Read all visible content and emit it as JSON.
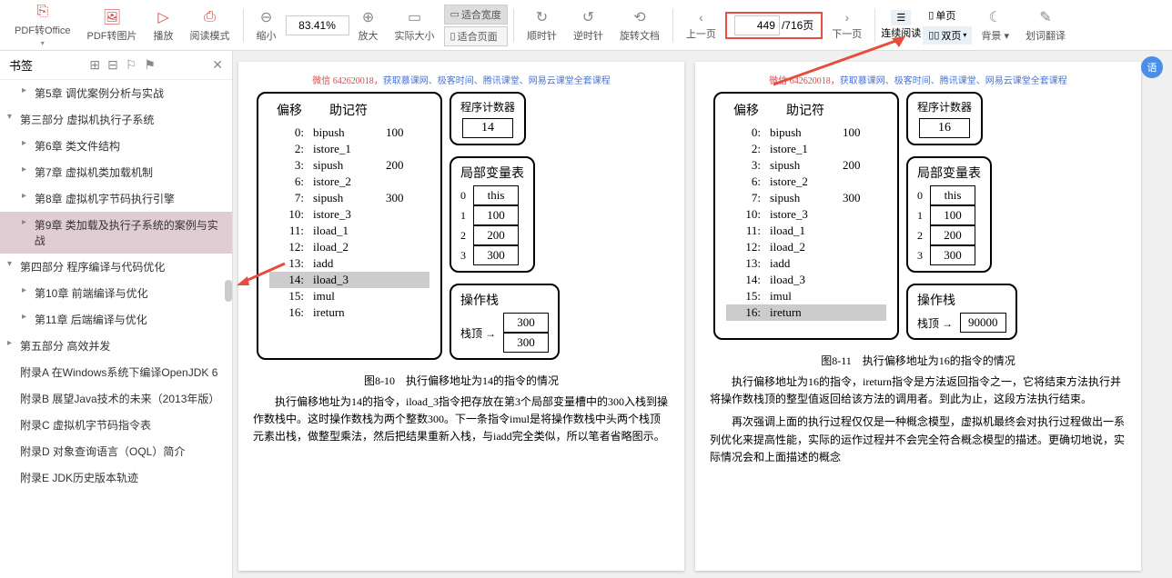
{
  "toolbar": {
    "pdf_office": "PDF转Office",
    "pdf_image": "PDF转图片",
    "play": "播放",
    "read_mode": "阅读模式",
    "zoom_out": "缩小",
    "zoom_value": "83.41%",
    "zoom_in": "放大",
    "actual_size": "实际大小",
    "fit_width": "适合宽度",
    "fit_page": "适合页面",
    "rotate_cw": "顺时针",
    "rotate_ccw": "逆时针",
    "rotate_doc": "旋转文档",
    "prev_page": "上一页",
    "page_current": "449",
    "page_total": "/716页",
    "next_page": "下一页",
    "continuous": "连续阅读",
    "single_page": "单页",
    "double_page": "双页",
    "background": "背景",
    "word_trans": "划词翻译"
  },
  "sidebar": {
    "title": "书签",
    "items": [
      {
        "label": "第5章 调优案例分析与实战",
        "lv": 1,
        "arrow": "▸"
      },
      {
        "label": "第三部分 虚拟机执行子系统",
        "lv": 0,
        "arrow": "▾"
      },
      {
        "label": "第6章 类文件结构",
        "lv": 1,
        "arrow": "▸"
      },
      {
        "label": "第7章 虚拟机类加载机制",
        "lv": 1,
        "arrow": "▸"
      },
      {
        "label": "第8章 虚拟机字节码执行引擎",
        "lv": 1,
        "arrow": "▸"
      },
      {
        "label": "第9章 类加载及执行子系统的案例与实战",
        "lv": 1,
        "arrow": "▸",
        "selected": true
      },
      {
        "label": "第四部分 程序编译与代码优化",
        "lv": 0,
        "arrow": "▾"
      },
      {
        "label": "第10章 前端编译与优化",
        "lv": 1,
        "arrow": "▸"
      },
      {
        "label": "第11章 后端编译与优化",
        "lv": 1,
        "arrow": "▸"
      },
      {
        "label": "第五部分 高效并发",
        "lv": 0,
        "arrow": "▸"
      },
      {
        "label": "附录A 在Windows系统下编译OpenJDK 6",
        "lv": 0,
        "arrow": ""
      },
      {
        "label": "附录B 展望Java技术的未来（2013年版）",
        "lv": 0,
        "arrow": ""
      },
      {
        "label": "附录C 虚拟机字节码指令表",
        "lv": 0,
        "arrow": ""
      },
      {
        "label": "附录D 对象查询语言（OQL）简介",
        "lv": 0,
        "arrow": ""
      },
      {
        "label": "附录E JDK历史版本轨迹",
        "lv": 0,
        "arrow": ""
      }
    ]
  },
  "doc": {
    "header_prefix": "微信 642620018，",
    "header_links": "获取慕课网、极客时间、腾讯课堂、网易云课堂全套课程",
    "left": {
      "code_title_offset": "偏移",
      "code_title_mnemonic": "助记符",
      "rows": [
        {
          "off": "0:",
          "mn": "bipush",
          "arg": "100"
        },
        {
          "off": "2:",
          "mn": "istore_1",
          "arg": ""
        },
        {
          "off": "3:",
          "mn": "sipush",
          "arg": "200"
        },
        {
          "off": "6:",
          "mn": "istore_2",
          "arg": ""
        },
        {
          "off": "7:",
          "mn": "sipush",
          "arg": "300"
        },
        {
          "off": "10:",
          "mn": "istore_3",
          "arg": ""
        },
        {
          "off": "11:",
          "mn": "iload_1",
          "arg": ""
        },
        {
          "off": "12:",
          "mn": "iload_2",
          "arg": ""
        },
        {
          "off": "13:",
          "mn": "iadd",
          "arg": ""
        },
        {
          "off": "14:",
          "mn": "iload_3",
          "arg": "",
          "hl": true
        },
        {
          "off": "15:",
          "mn": "imul",
          "arg": ""
        },
        {
          "off": "16:",
          "mn": "ireturn",
          "arg": ""
        }
      ],
      "pc_title": "程序计数器",
      "pc_value": "14",
      "var_title": "局部变量表",
      "vars": [
        {
          "i": "0",
          "v": "this"
        },
        {
          "i": "1",
          "v": "100"
        },
        {
          "i": "2",
          "v": "200"
        },
        {
          "i": "3",
          "v": "300"
        }
      ],
      "stack_title": "操作栈",
      "stack_label": "栈顶 →",
      "stack": [
        "300",
        "300"
      ],
      "caption": "图8-10　执行偏移地址为14的指令的情况",
      "para": "执行偏移地址为14的指令，iload_3指令把存放在第3个局部变量槽中的300入栈到操作数栈中。这时操作数栈为两个整数300。下一条指令imul是将操作数栈中头两个栈顶元素出栈，做整型乘法，然后把结果重新入栈，与iadd完全类似，所以笔者省略图示。"
    },
    "right": {
      "code_title_offset": "偏移",
      "code_title_mnemonic": "助记符",
      "rows": [
        {
          "off": "0:",
          "mn": "bipush",
          "arg": "100"
        },
        {
          "off": "2:",
          "mn": "istore_1",
          "arg": ""
        },
        {
          "off": "3:",
          "mn": "sipush",
          "arg": "200"
        },
        {
          "off": "6:",
          "mn": "istore_2",
          "arg": ""
        },
        {
          "off": "7:",
          "mn": "sipush",
          "arg": "300"
        },
        {
          "off": "10:",
          "mn": "istore_3",
          "arg": ""
        },
        {
          "off": "11:",
          "mn": "iload_1",
          "arg": ""
        },
        {
          "off": "12:",
          "mn": "iload_2",
          "arg": ""
        },
        {
          "off": "13:",
          "mn": "iadd",
          "arg": ""
        },
        {
          "off": "14:",
          "mn": "iload_3",
          "arg": ""
        },
        {
          "off": "15:",
          "mn": "imul",
          "arg": ""
        },
        {
          "off": "16:",
          "mn": "ireturn",
          "arg": "",
          "hl": true
        }
      ],
      "pc_title": "程序计数器",
      "pc_value": "16",
      "var_title": "局部变量表",
      "vars": [
        {
          "i": "0",
          "v": "this"
        },
        {
          "i": "1",
          "v": "100"
        },
        {
          "i": "2",
          "v": "200"
        },
        {
          "i": "3",
          "v": "300"
        }
      ],
      "stack_title": "操作栈",
      "stack_label": "栈顶 →",
      "stack": [
        "90000"
      ],
      "caption": "图8-11　执行偏移地址为16的指令的情况",
      "para1": "执行偏移地址为16的指令，ireturn指令是方法返回指令之一，它将结束方法执行并将操作数栈顶的整型值返回给该方法的调用者。到此为止，这段方法执行结束。",
      "para2": "再次强调上面的执行过程仅仅是一种概念模型，虚拟机最终会对执行过程做出一系列优化来提高性能，实际的运作过程并不会完全符合概念模型的描述。更确切地说，实际情况会和上面描述的概念"
    }
  }
}
